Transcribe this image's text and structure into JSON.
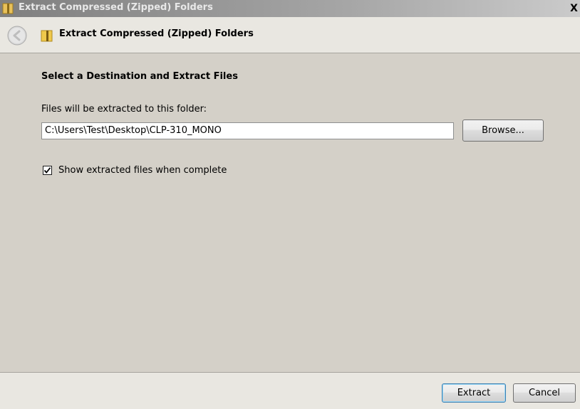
{
  "window": {
    "title": "Extract Compressed (Zipped) Folders",
    "close_glyph": "X"
  },
  "header": {
    "title": "Extract Compressed (Zipped) Folders",
    "back_icon": "back-arrow-icon",
    "folder_icon": "zip-folder-icon"
  },
  "content": {
    "heading": "Select a Destination and Extract Files",
    "field_label": "Files will be extracted to this folder:",
    "destination_path": "C:\\Users\\Test\\Desktop\\CLP-310_MONO",
    "browse_label": "Browse...",
    "checkbox_label": "Show extracted files when complete",
    "checkbox_checked": true
  },
  "footer": {
    "extract_label": "Extract",
    "cancel_label": "Cancel"
  },
  "colors": {
    "dialog_bg": "#d4d0c8",
    "header_bg": "#e9e7e1",
    "default_button_border": "#3c7fb1"
  }
}
